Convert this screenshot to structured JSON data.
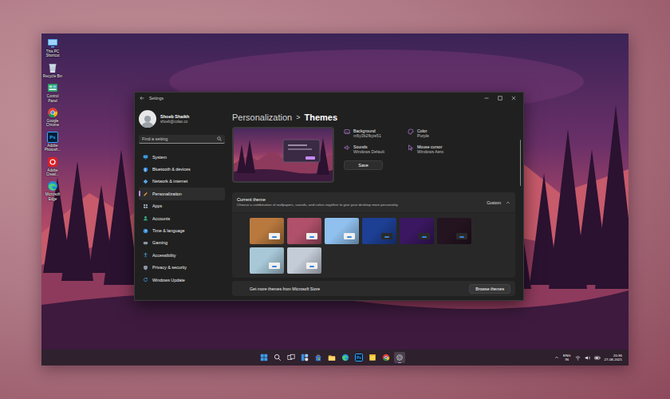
{
  "desktop": {
    "icons": [
      {
        "label": "This PC Shortcut",
        "kind": "pc"
      },
      {
        "label": "Recycle Bin",
        "kind": "bin"
      },
      {
        "label": "Control Panel",
        "kind": "control"
      },
      {
        "label": "Google Chrome",
        "kind": "chrome"
      },
      {
        "label": "Adobe Photosh...",
        "kind": "photoshop",
        "glyph": "Ps"
      },
      {
        "label": "Adobe Creati...",
        "kind": "creative"
      },
      {
        "label": "Microsoft Edge",
        "kind": "edge"
      }
    ]
  },
  "window": {
    "title": "Settings"
  },
  "profile": {
    "name": "Shoeb Shaikh",
    "email": "shoeb@colao.co"
  },
  "search": {
    "placeholder": "Find a setting"
  },
  "sidebar": {
    "items": [
      {
        "label": "System",
        "kind": "system",
        "selected": false
      },
      {
        "label": "Bluetooth & devices",
        "kind": "bluetooth",
        "selected": false
      },
      {
        "label": "Network & internet",
        "kind": "network",
        "selected": false
      },
      {
        "label": "Personalization",
        "kind": "personalization",
        "selected": true
      },
      {
        "label": "Apps",
        "kind": "apps",
        "selected": false
      },
      {
        "label": "Accounts",
        "kind": "accounts",
        "selected": false
      },
      {
        "label": "Time & language",
        "kind": "time",
        "selected": false
      },
      {
        "label": "Gaming",
        "kind": "gaming",
        "selected": false
      },
      {
        "label": "Accessibility",
        "kind": "accessibility",
        "selected": false
      },
      {
        "label": "Privacy & security",
        "kind": "privacy",
        "selected": false
      },
      {
        "label": "Windows Update",
        "kind": "update",
        "selected": false
      }
    ]
  },
  "breadcrumb": {
    "parent": "Personalization",
    "separator": ">",
    "current": "Themes"
  },
  "properties": [
    {
      "label": "Background",
      "value": "m6y3b2fkyie51",
      "kind": "background"
    },
    {
      "label": "Color",
      "value": "Purple",
      "kind": "color"
    },
    {
      "label": "Sounds",
      "value": "Windows Default",
      "kind": "sounds"
    },
    {
      "label": "Mouse cursor",
      "value": "Windows Aero",
      "kind": "cursor"
    }
  ],
  "save_button": "Save",
  "current_theme": {
    "title": "Current theme",
    "description": "Choose a combination of wallpapers, sounds, and colors together to give your desktop more personality.",
    "value": "Custom",
    "expanded": true,
    "themes": [
      {
        "color": "#b9793e"
      },
      {
        "color": "#b0506a"
      },
      {
        "color": "#8fc0ee"
      },
      {
        "color": "#1d3f94"
      },
      {
        "color": "#3a1760"
      },
      {
        "color": "#241420"
      },
      {
        "color": "#a8c8d8"
      },
      {
        "color": "#c4ccd8"
      }
    ]
  },
  "store": {
    "label": "Get more themes from Microsoft Store",
    "button": "Browse themes"
  },
  "taskbar": {
    "apps": [
      {
        "kind": "start",
        "active": false
      },
      {
        "kind": "search",
        "active": false
      },
      {
        "kind": "taskview",
        "active": false
      },
      {
        "kind": "widgets",
        "active": false
      },
      {
        "kind": "store",
        "active": false
      },
      {
        "kind": "explorer",
        "active": false
      },
      {
        "kind": "edge",
        "active": false
      },
      {
        "kind": "photoshop",
        "glyph": "Ps",
        "active": false
      },
      {
        "kind": "notes",
        "active": false
      },
      {
        "kind": "chrome",
        "active": false
      },
      {
        "kind": "settings",
        "active": true
      }
    ],
    "language": {
      "line1": "ENG",
      "line2": "IN"
    },
    "time": "20:36",
    "date": "27-08-2021"
  }
}
